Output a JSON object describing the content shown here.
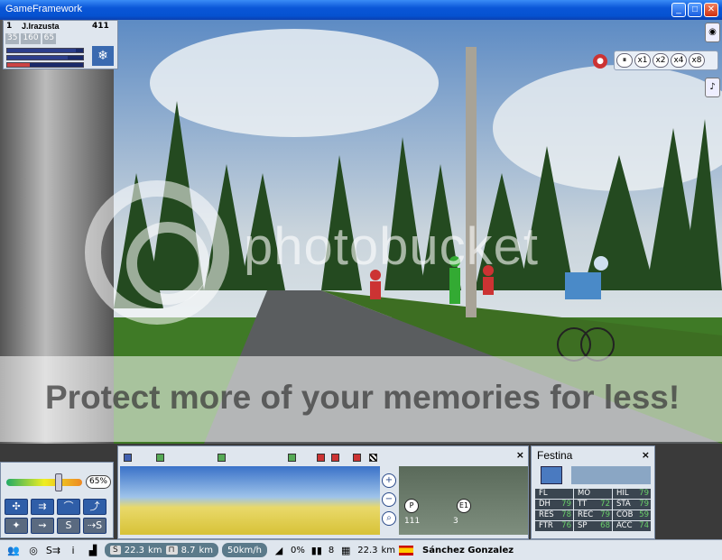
{
  "window": {
    "title": "GameFramework"
  },
  "rider_panel": {
    "position": "1",
    "name": "J.Irazusta",
    "number": "411",
    "stats": [
      "35",
      "160",
      "65"
    ]
  },
  "speed_controls": [
    "x1",
    "x2",
    "x4",
    "x8"
  ],
  "watermark": {
    "brand": "photobucket",
    "tagline": "Protect more of your memories for less!"
  },
  "effort": {
    "percent": "65%",
    "level": 0.65
  },
  "route": {
    "map_nodes": [
      "P",
      "E1"
    ],
    "map_values": [
      "111",
      "3"
    ]
  },
  "team": {
    "name": "Festina",
    "stats": [
      {
        "k": "FL",
        "v": ""
      },
      {
        "k": "MO",
        "v": ""
      },
      {
        "k": "HIL",
        "v": "79"
      },
      {
        "k": "DH",
        "v": "79"
      },
      {
        "k": "TT",
        "v": "72"
      },
      {
        "k": "STA",
        "v": "79"
      },
      {
        "k": "RES",
        "v": "78"
      },
      {
        "k": "REC",
        "v": "79"
      },
      {
        "k": "COB",
        "v": "59"
      },
      {
        "k": "FTR",
        "v": "76"
      },
      {
        "k": "SP",
        "v": "68"
      },
      {
        "k": "ACC",
        "v": "74"
      }
    ]
  },
  "statusbar": {
    "info": "i",
    "dist_done": "22.3",
    "dist_left": "8.7",
    "unit_km": "km",
    "speed": "50km/h",
    "gradient": "0%",
    "group_count": "8",
    "dist_total": "22.3",
    "rider_name": "Sánchez Gonzalez"
  }
}
